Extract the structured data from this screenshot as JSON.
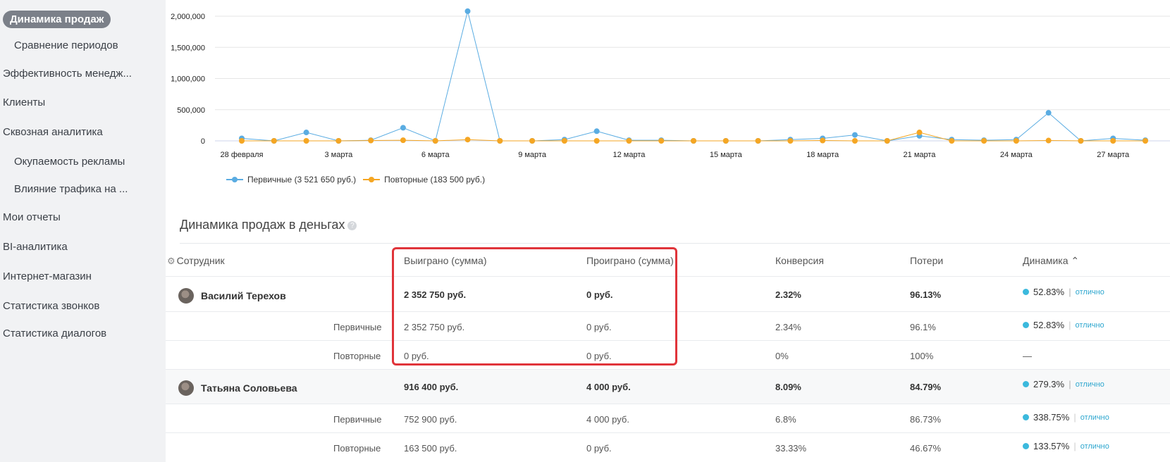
{
  "sidebar": {
    "items": [
      {
        "label": "Динамика продаж"
      },
      {
        "label": "Сравнение периодов"
      },
      {
        "label": "Эффективность менедж..."
      },
      {
        "label": "Клиенты"
      },
      {
        "label": "Сквозная аналитика"
      },
      {
        "label": "Окупаемость рекламы"
      },
      {
        "label": "Влияние трафика на ..."
      },
      {
        "label": "Мои отчеты"
      },
      {
        "label": "BI-аналитика"
      },
      {
        "label": "Интернет-магазин"
      },
      {
        "label": "Статистика звонков"
      },
      {
        "label": "Статистика диалогов"
      }
    ]
  },
  "chart_data": {
    "type": "line",
    "x_labels": [
      "28 февраля",
      "1 марта",
      "2 марта",
      "3 марта",
      "4 марта",
      "5 марта",
      "6 марта",
      "7 марта",
      "8 марта",
      "9 марта",
      "10 марта",
      "11 марта",
      "12 марта",
      "13 марта",
      "14 марта",
      "15 марта",
      "16 марта",
      "17 марта",
      "18 марта",
      "19 марта",
      "20 марта",
      "21 марта",
      "22 марта",
      "23 марта",
      "24 марта",
      "25 марта",
      "26 марта",
      "27 марта",
      "28 марта"
    ],
    "x_tick_labels": [
      "28 февраля",
      "3 марта",
      "6 марта",
      "9 марта",
      "12 марта",
      "15 марта",
      "18 марта",
      "21 марта",
      "24 марта",
      "27 марта"
    ],
    "y_ticks": [
      "2,000,000",
      "1,500,000",
      "1,000,000",
      "500,000",
      "0"
    ],
    "ylim": [
      0,
      2000000
    ],
    "series": [
      {
        "name": "Первичные (3 521 650 руб.)",
        "color": "#5aace2",
        "values": [
          40000,
          0,
          135000,
          0,
          10000,
          210000,
          0,
          2080000,
          0,
          0,
          20000,
          155000,
          10000,
          10000,
          0,
          0,
          0,
          20000,
          40000,
          95000,
          0,
          80000,
          20000,
          10000,
          20000,
          450000,
          0,
          40000,
          10000
        ]
      },
      {
        "name": "Повторные (183 500 руб.)",
        "color": "#f5a623",
        "values": [
          0,
          0,
          0,
          0,
          5000,
          10000,
          0,
          20000,
          0,
          0,
          0,
          0,
          0,
          0,
          0,
          0,
          0,
          0,
          5000,
          0,
          0,
          135000,
          0,
          0,
          0,
          5000,
          0,
          0,
          0
        ]
      }
    ]
  },
  "table": {
    "title": "Динамика продаж в деньгах",
    "help": "?",
    "headers": {
      "employee": "Сотрудник",
      "won": "Выиграно (сумма)",
      "lost": "Проиграно (сумма)",
      "conversion": "Конверсия",
      "losses": "Потери",
      "dynamics": "Динамика ⌃"
    },
    "rows": [
      {
        "name": "Василий Терехов",
        "won": "2 352 750 руб.",
        "lost": "0 руб.",
        "conversion": "2.32%",
        "losses": "96.13%",
        "dynamics": "52.83%",
        "tag": "отлично"
      },
      {
        "sub": "Первичные",
        "won": "2 352 750 руб.",
        "lost": "0 руб.",
        "conversion": "2.34%",
        "losses": "96.1%",
        "dynamics": "52.83%",
        "tag": "отлично"
      },
      {
        "sub": "Повторные",
        "won": "0 руб.",
        "lost": "0 руб.",
        "conversion": "0%",
        "losses": "100%",
        "dynamics": "—"
      },
      {
        "name": "Татьяна Соловьева",
        "won": "916 400 руб.",
        "lost": "4 000 руб.",
        "conversion": "8.09%",
        "losses": "84.79%",
        "dynamics": "279.3%",
        "tag": "отлично"
      },
      {
        "sub": "Первичные",
        "won": "752 900 руб.",
        "lost": "4 000 руб.",
        "conversion": "6.8%",
        "losses": "86.73%",
        "dynamics": "338.75%",
        "tag": "отлично"
      },
      {
        "sub": "Повторные",
        "won": "163 500 руб.",
        "lost": "0 руб.",
        "conversion": "33.33%",
        "losses": "46.67%",
        "dynamics": "133.57%",
        "tag": "отлично"
      }
    ]
  },
  "colors": {
    "highlight": "#e0343a",
    "status_dot": "#3bb9dd",
    "link": "#2a64a8"
  }
}
